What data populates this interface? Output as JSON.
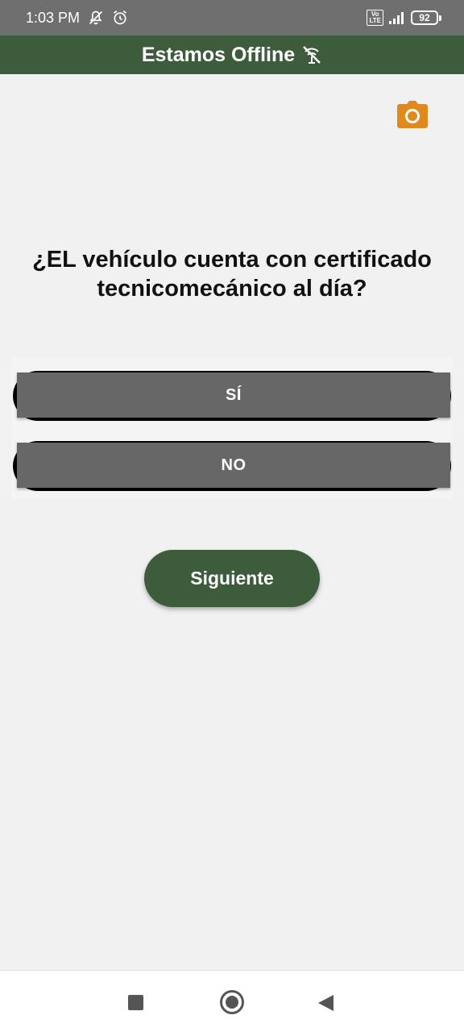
{
  "status_bar": {
    "time": "1:03 PM",
    "icons": [
      "notifications-off-icon",
      "alarm-icon",
      "volte-icon",
      "signal-icon",
      "battery-icon"
    ],
    "volte_top": "Vo",
    "volte_bottom": "LTE",
    "battery_level": "92"
  },
  "header": {
    "title": "Estamos Offline",
    "icon": "no-signal-icon",
    "background": "#3c5c3c"
  },
  "camera": {
    "icon": "camera-icon",
    "color": "#e08a1e"
  },
  "question": {
    "text": "¿EL vehículo cuenta con certificado tecnicomecánico al día?"
  },
  "options": [
    {
      "label": "SÍ"
    },
    {
      "label": "NO"
    }
  ],
  "next_button": {
    "label": "Siguiente"
  },
  "nav_bar": {
    "icons": [
      "recent-apps-icon",
      "home-icon",
      "back-icon"
    ]
  },
  "colors": {
    "primary": "#3c5c3c",
    "option_bg": "#676767",
    "page_bg": "#f1f1f1",
    "accent": "#e08a1e"
  }
}
